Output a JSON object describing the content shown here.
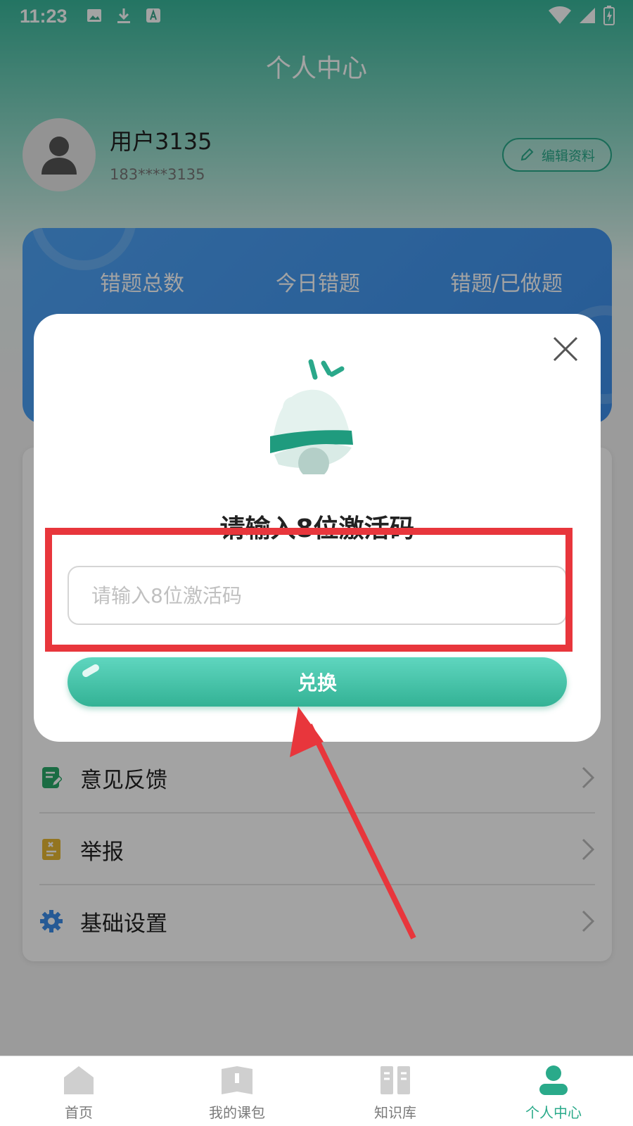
{
  "status_bar": {
    "time": "11:23"
  },
  "page": {
    "title": "个人中心"
  },
  "profile": {
    "username": "用户3135",
    "phone": "183****3135",
    "edit_label": "编辑资料"
  },
  "stats": {
    "labels": [
      "错题总数",
      "今日错题",
      "错题/已做题"
    ]
  },
  "menu": {
    "items": [
      {
        "label": "意见反馈",
        "icon": "feedback-icon",
        "color": "#2aaa6a"
      },
      {
        "label": "举报",
        "icon": "report-icon",
        "color": "#e7b733"
      },
      {
        "label": "基础设置",
        "icon": "gear-icon",
        "color": "#3c8ee9"
      }
    ]
  },
  "tabs": [
    {
      "label": "首页",
      "icon": "home-icon",
      "active": false
    },
    {
      "label": "我的课包",
      "icon": "book-icon",
      "active": false
    },
    {
      "label": "知识库",
      "icon": "library-icon",
      "active": false
    },
    {
      "label": "个人中心",
      "icon": "person-icon",
      "active": true
    }
  ],
  "dialog": {
    "title": "请输入8位激活码",
    "input_placeholder": "请输入8位激活码",
    "input_value": "",
    "button_label": "兑换"
  },
  "colors": {
    "accent": "#2aaa8a",
    "stats_card": "#4ea3f6",
    "annotation": "#e8363c"
  }
}
